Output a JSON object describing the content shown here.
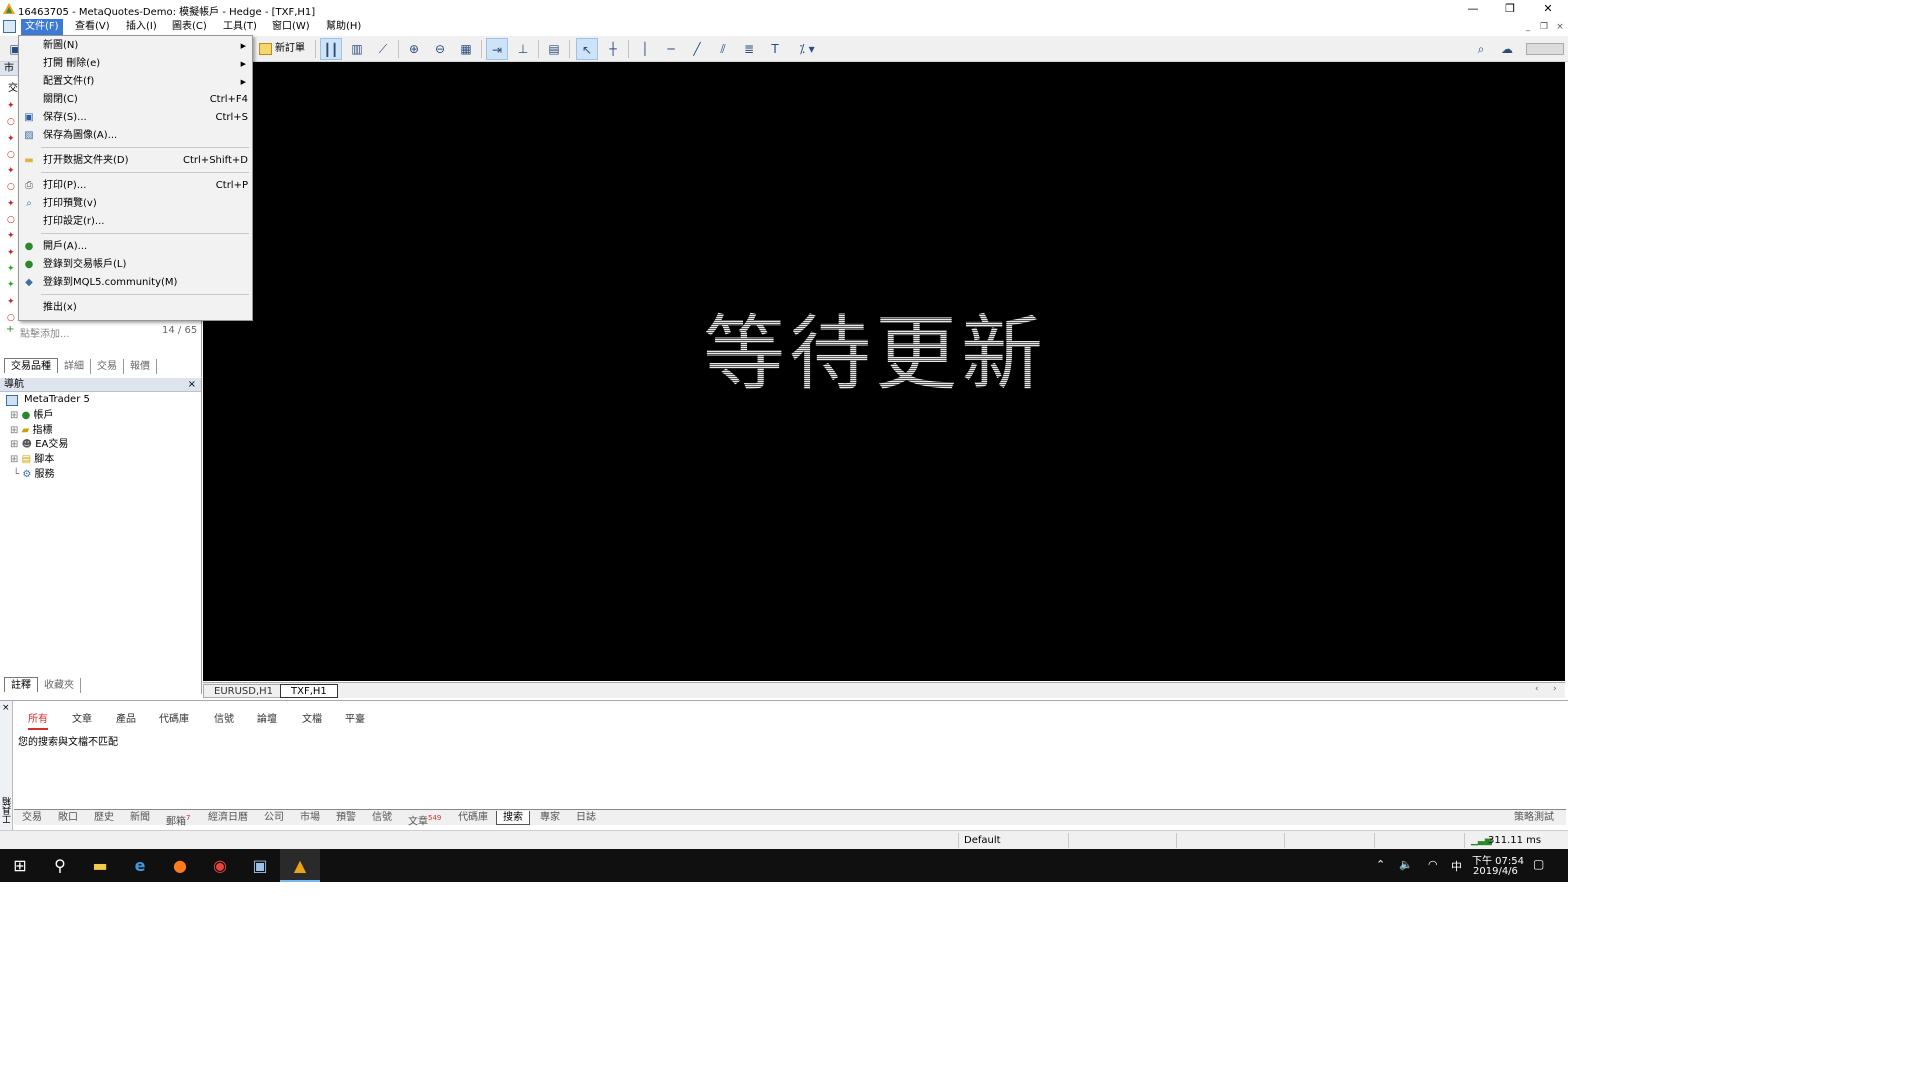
{
  "window": {
    "title": "16463705 - MetaQuotes-Demo: 模擬帳戶 - Hedge - [TXF,H1]"
  },
  "menubar": [
    "文件(F)",
    "查看(V)",
    "插入(I)",
    "圖表(C)",
    "工具(T)",
    "窗口(W)",
    "幫助(H)"
  ],
  "toolbar": {
    "new_order": "新訂單"
  },
  "file_menu": {
    "items": [
      {
        "label": "新圖(N)",
        "shortcut": "",
        "submenu": true,
        "icon": ""
      },
      {
        "label": "打開 刪除(e)",
        "shortcut": "",
        "submenu": true,
        "icon": ""
      },
      {
        "label": "配置文件(f)",
        "shortcut": "",
        "submenu": true,
        "icon": ""
      },
      {
        "label": "關閉(C)",
        "shortcut": "Ctrl+F4",
        "submenu": false,
        "icon": ""
      },
      {
        "label": "保存(S)...",
        "shortcut": "Ctrl+S",
        "submenu": false,
        "icon": "save-icon"
      },
      {
        "label": "保存為圖像(A)...",
        "shortcut": "",
        "submenu": false,
        "icon": "image-icon"
      },
      {
        "label": "打开数据文件夹(D)",
        "shortcut": "Ctrl+Shift+D",
        "submenu": false,
        "icon": "folder-icon"
      },
      {
        "label": "打印(P)...",
        "shortcut": "Ctrl+P",
        "submenu": false,
        "icon": "printer-icon"
      },
      {
        "label": "打印預覽(v)",
        "shortcut": "",
        "submenu": false,
        "icon": "preview-icon"
      },
      {
        "label": "打印設定(r)...",
        "shortcut": "",
        "submenu": false,
        "icon": ""
      },
      {
        "label": "開戶(A)...",
        "shortcut": "",
        "submenu": false,
        "icon": "account-icon"
      },
      {
        "label": "登錄到交易帳戶(L)",
        "shortcut": "",
        "submenu": false,
        "icon": "login-icon"
      },
      {
        "label": "登錄到MQL5.community(M)",
        "shortcut": "",
        "submenu": false,
        "icon": "mql5-icon"
      },
      {
        "label": "推出(x)",
        "shortcut": "",
        "submenu": false,
        "icon": ""
      }
    ]
  },
  "market_watch": {
    "title": "市",
    "col": "交",
    "add_label": "點擊添加...",
    "count": "14 / 65",
    "tabs": [
      "交易品種",
      "詳細",
      "交易",
      "報價"
    ]
  },
  "navigator": {
    "title": "導航",
    "close": "×",
    "root": "MetaTrader 5",
    "items": [
      "帳戶",
      "指標",
      "EA交易",
      "腳本",
      "服務"
    ],
    "tabs": [
      "註釋",
      "收藏夾"
    ]
  },
  "chart": {
    "waiting_text": "等待更新",
    "tabs": [
      "EURUSD,H1",
      "TXF,H1"
    ]
  },
  "toolbox": {
    "filters": [
      "所有",
      "文章",
      "產品",
      "代碼庫",
      "信號",
      "論壇",
      "文檔",
      "平臺"
    ],
    "message": "您的搜索與文檔不匹配",
    "side_label": "工具箱",
    "tabs": [
      "交易",
      "敞口",
      "歷史",
      "新聞",
      "郵箱",
      "經濟日曆",
      "公司",
      "市場",
      "預警",
      "信號",
      "文章",
      "代碼庫",
      "搜索",
      "專家",
      "日誌"
    ],
    "mail_badge": "7",
    "article_badge": "549",
    "strategy_tester": "策略測試"
  },
  "statusbar": {
    "profile": "Default",
    "ping": "311.11 ms"
  },
  "taskbar": {
    "time": "下午 07:54",
    "date": "2019/4/6",
    "ime": "中"
  }
}
